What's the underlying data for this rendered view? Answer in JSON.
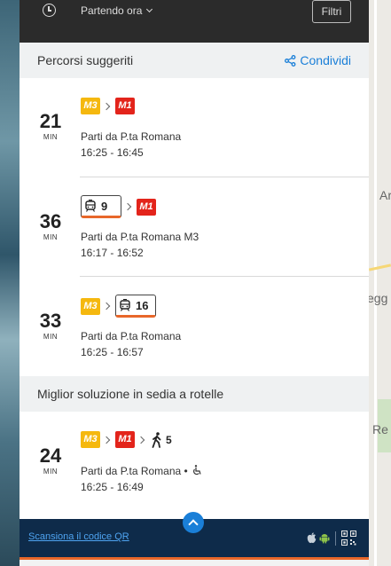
{
  "topbar": {
    "departure_label": "Partendo ora",
    "filters_label": "Filtri"
  },
  "suggested": {
    "title": "Percorsi suggeriti",
    "share_label": "Condividi",
    "routes": [
      {
        "minutes": "21",
        "min_label": "MIN",
        "from": "Parti da P.ta Romana",
        "times": "16:25  -  16:45"
      },
      {
        "minutes": "36",
        "min_label": "MIN",
        "from": "Parti da P.ta Romana M3",
        "times": "16:17  -  16:52",
        "tram_line": "9"
      },
      {
        "minutes": "33",
        "min_label": "MIN",
        "from": "Parti da P.ta Romana",
        "times": "16:25  -  16:57",
        "tram_line": "16"
      }
    ]
  },
  "wheelchair": {
    "title": "Miglior soluzione in sedia a rotelle",
    "route": {
      "minutes": "24",
      "min_label": "MIN",
      "from": "Parti da P.ta Romana •",
      "times": "16:25  -  16:49",
      "walk_minutes": "5"
    }
  },
  "badges": {
    "m3": "M3",
    "m1": "M1"
  },
  "footer": {
    "qr_link": "Scansiona il codice QR"
  },
  "map_labels": {
    "a": "Ar",
    "b": "egg",
    "c": "Re"
  },
  "colors": {
    "m3": "#f5b80f",
    "m1": "#e3241b",
    "accent": "#1a7fd8",
    "tram_underline": "#e8672a",
    "footer_bg": "#0e2b4a"
  },
  "icons": [
    "clock-icon",
    "chevron-down-icon",
    "share-icon",
    "tram-icon",
    "walk-icon",
    "wheelchair-icon",
    "apple-icon",
    "android-icon",
    "qr-code-icon",
    "chevron-up-icon"
  ]
}
